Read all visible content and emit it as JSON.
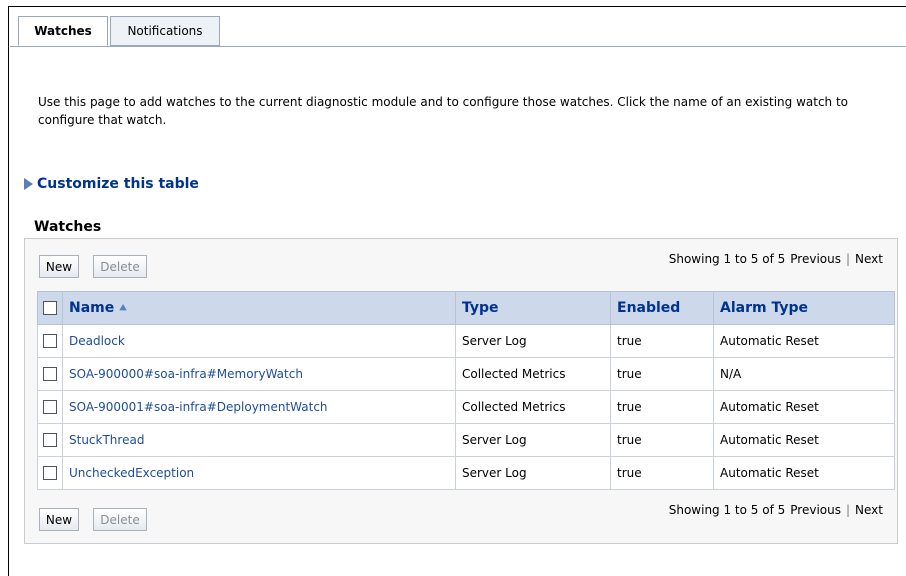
{
  "tabs": [
    {
      "label": "Watches",
      "active": true
    },
    {
      "label": "Notifications",
      "active": false
    }
  ],
  "intro": "Use this page to add watches to the current diagnostic module and to configure those watches. Click the name of an existing watch to configure that watch.",
  "customize_label": "Customize this table",
  "section_title": "Watches",
  "toolbar": {
    "new_label": "New",
    "delete_label": "Delete",
    "showing": "Showing 1 to 5 of 5",
    "previous": "Previous",
    "next": "Next"
  },
  "table": {
    "columns": [
      "Name",
      "Type",
      "Enabled",
      "Alarm Type"
    ],
    "sort_icon": "sort-ascending-icon",
    "rows": [
      {
        "name": "Deadlock",
        "type": "Server Log",
        "enabled": "true",
        "alarm": "Automatic Reset"
      },
      {
        "name": "SOA-900000#soa-infra#MemoryWatch",
        "type": "Collected Metrics",
        "enabled": "true",
        "alarm": "N/A"
      },
      {
        "name": "SOA-900001#soa-infra#DeploymentWatch",
        "type": "Collected Metrics",
        "enabled": "true",
        "alarm": "Automatic Reset"
      },
      {
        "name": "StuckThread",
        "type": "Server Log",
        "enabled": "true",
        "alarm": "Automatic Reset"
      },
      {
        "name": "UncheckedException",
        "type": "Server Log",
        "enabled": "true",
        "alarm": "Automatic Reset"
      }
    ]
  },
  "colors": {
    "link": "#1e4d99",
    "header_bg": "#cdd9ea",
    "header_text": "#00338d"
  }
}
